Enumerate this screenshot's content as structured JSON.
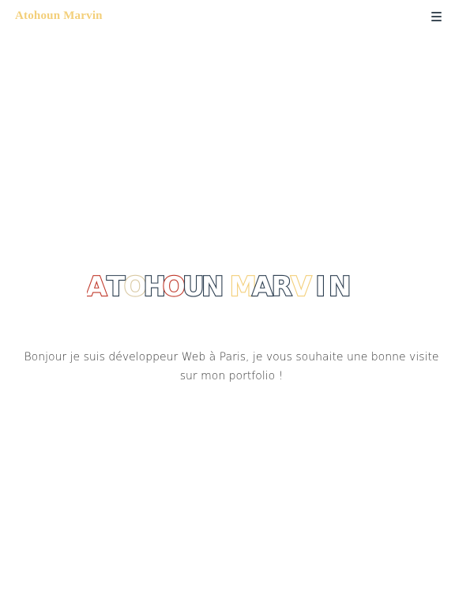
{
  "nav": {
    "brand": "Atohoun Marvin",
    "menu_icon": "hamburger-menu-icon"
  },
  "hero": {
    "title": "ATOHOUN MARVIN",
    "letter_colors": [
      "#c0392b",
      "#2c3e50",
      "#d9c9a3",
      "#2c3e50",
      "#c0392b",
      "#2c3e50",
      "#2c3e50",
      "#f3cf7a",
      "#2c3e50",
      "#2c3e50",
      "#f3cf7a",
      "#2c3e50",
      "#2c3e50",
      "#2c3e50"
    ],
    "intro": "Bonjour je suis développeur Web à Paris, je vous souhaite une bonne visite sur mon portfolio !"
  },
  "colors": {
    "accent": "#f3cf7a",
    "dark": "#2c3e50",
    "red": "#c0392b",
    "beige": "#d9c9a3"
  }
}
